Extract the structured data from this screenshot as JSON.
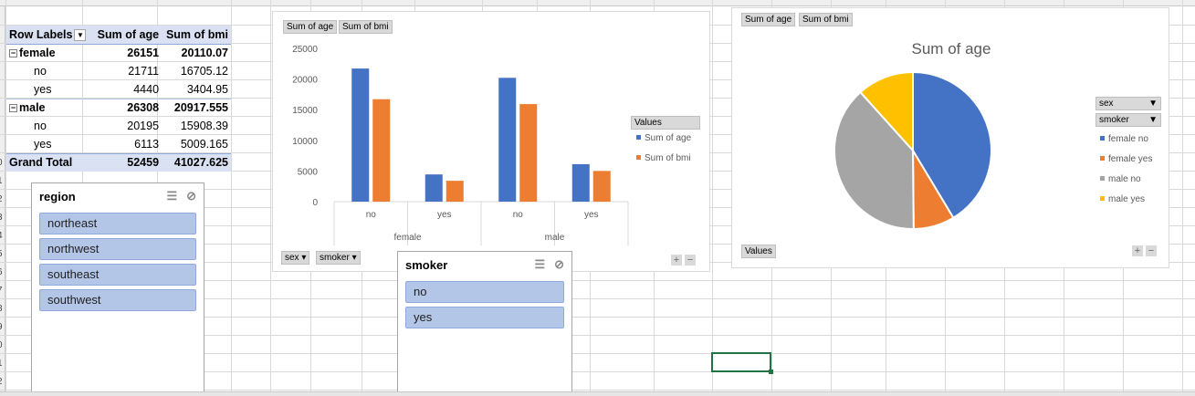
{
  "sheet": {
    "row_numbers": [
      "0",
      "1",
      "2",
      "3",
      "4",
      "5",
      "6",
      "7",
      "8",
      "9",
      "0",
      "1",
      "2"
    ]
  },
  "pivot_table": {
    "headers": {
      "row_labels": "Row Labels",
      "sum_age": "Sum of age",
      "sum_bmi": "Sum of bmi"
    },
    "rows": [
      {
        "label": "female",
        "age": "26151",
        "bmi": "20110.07",
        "level": "group"
      },
      {
        "label": "no",
        "age": "21711",
        "bmi": "16705.12",
        "level": "item"
      },
      {
        "label": "yes",
        "age": "4440",
        "bmi": "3404.95",
        "level": "item"
      },
      {
        "label": "male",
        "age": "26308",
        "bmi": "20917.555",
        "level": "group"
      },
      {
        "label": "no",
        "age": "20195",
        "bmi": "15908.39",
        "level": "item"
      },
      {
        "label": "yes",
        "age": "6113",
        "bmi": "5009.165",
        "level": "item"
      }
    ],
    "total": {
      "label": "Grand Total",
      "age": "52459",
      "bmi": "41027.625"
    }
  },
  "region_slicer": {
    "title": "region",
    "items": [
      "northeast",
      "northwest",
      "southeast",
      "southwest"
    ]
  },
  "smoker_slicer": {
    "title": "smoker",
    "items": [
      "no",
      "yes"
    ]
  },
  "bar_chart_ui": {
    "value_buttons": [
      "Sum of age",
      "Sum of bmi"
    ],
    "axis_buttons": [
      "sex",
      "smoker"
    ],
    "legend_button": "Values",
    "legend_items": [
      "Sum of age",
      "Sum of bmi"
    ]
  },
  "pie_chart_ui": {
    "value_buttons": [
      "Sum of age",
      "Sum of bmi"
    ],
    "field_buttons": [
      "sex",
      "smoker"
    ],
    "values_button": "Values",
    "legend_items": [
      "female no",
      "female yes",
      "male no",
      "male yes"
    ]
  },
  "colors": {
    "blue": "#4472c4",
    "orange": "#ed7d31",
    "gray": "#a5a5a5",
    "yellow": "#ffc000",
    "header_fill": "#d9e1f2",
    "slicer_item": "#b4c6e7"
  },
  "chart_data": [
    {
      "type": "bar",
      "categories": [
        "no",
        "yes",
        "no",
        "yes"
      ],
      "groups": [
        "female",
        "male"
      ],
      "series": [
        {
          "name": "Sum of age",
          "values": [
            21711,
            4440,
            20195,
            6113
          ]
        },
        {
          "name": "Sum of bmi",
          "values": [
            16705.12,
            3404.95,
            15908.39,
            5009.165
          ]
        }
      ],
      "ylim": [
        0,
        25000
      ],
      "yticks": [
        "0",
        "5000",
        "10000",
        "15000",
        "20000",
        "25000"
      ],
      "grid": false,
      "legend": "right"
    },
    {
      "type": "pie",
      "title": "Sum of age",
      "labels": [
        "female no",
        "female yes",
        "male no",
        "male yes"
      ],
      "values": [
        21711,
        4440,
        20195,
        6113
      ],
      "legend": "right"
    }
  ]
}
